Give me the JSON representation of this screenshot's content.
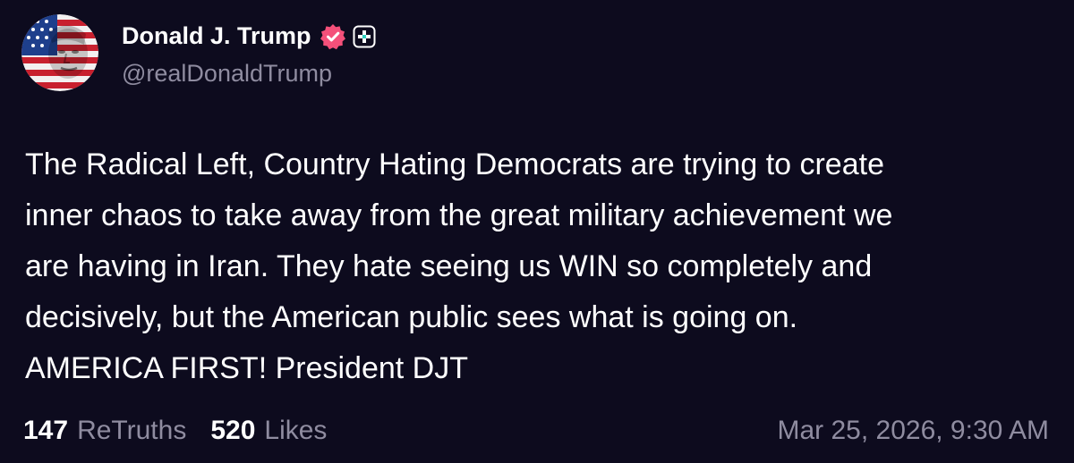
{
  "author": {
    "display_name": "Donald J. Trump",
    "handle": "@realDonaldTrump",
    "verified_icon": "verified-check-icon",
    "verified_color": "#f4507a",
    "plus_icon": "plus-badge-icon"
  },
  "post": {
    "text": "The Radical Left, Country Hating Democrats are trying to create\ninner chaos to take away from the great military achievement we\nare having in Iran. They hate seeing us WIN so completely and\ndecisively, but the American public sees what is going on.\nAMERICA FIRST! President DJT"
  },
  "stats": {
    "retruths_count": "147",
    "retruths_label": "ReTruths",
    "likes_count": "520",
    "likes_label": "Likes"
  },
  "timestamp": "Mar 25, 2026, 9:30 AM",
  "colors": {
    "background": "#0d0b1e",
    "text_primary": "#ffffff",
    "text_secondary": "#8f8ca0"
  }
}
